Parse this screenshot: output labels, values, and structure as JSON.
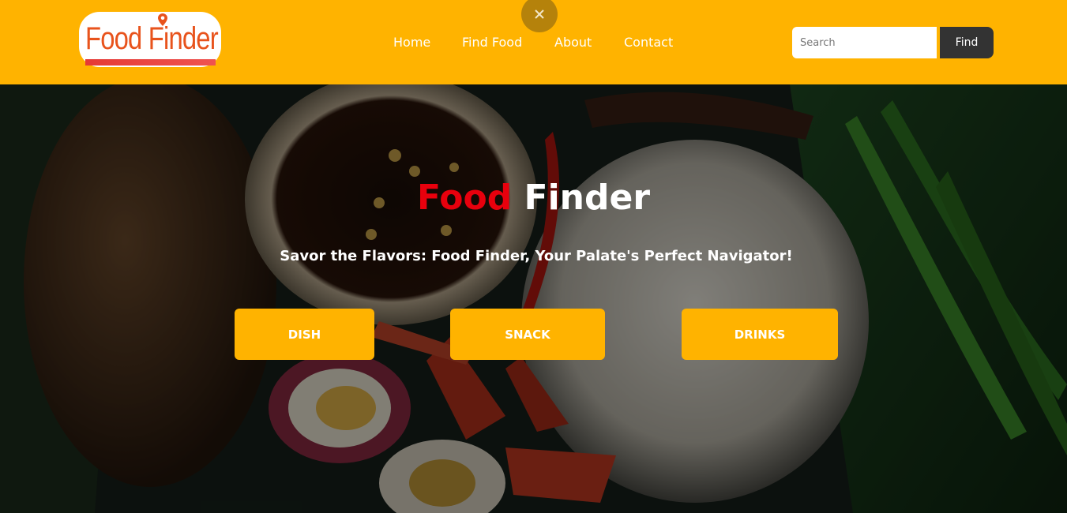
{
  "brand": {
    "logo_text": "Food Finder"
  },
  "nav": {
    "links": [
      "Home",
      "Find Food",
      "About",
      "Contact"
    ]
  },
  "search": {
    "placeholder": "Search",
    "button_label": "Find"
  },
  "hero": {
    "title_accent": "Food",
    "title_rest": "Finder",
    "tagline": "Savor the Flavors: Food Finder, Your Palate's Perfect Navigator!",
    "categories": [
      "DISH",
      "SNACK",
      "DRINKS"
    ]
  },
  "colors": {
    "navbar": "#ffb300",
    "accent_red": "#e8000d",
    "button": "#ffb300",
    "find_button": "#333333"
  },
  "icons": {
    "close": "close-icon",
    "location_pin": "location-pin-icon"
  }
}
